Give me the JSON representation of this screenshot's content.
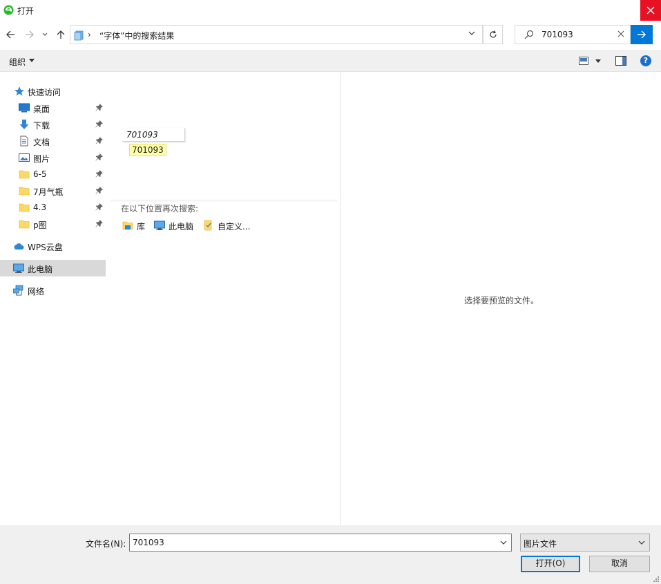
{
  "window": {
    "title": "打开",
    "accent": "#0078d7",
    "close_color": "#e81123"
  },
  "nav": {
    "address_separator": "›",
    "address_path": "“字体”中的搜索结果",
    "search_value": "701093",
    "search_placeholder": ""
  },
  "toolbar": {
    "organize_label": "组织",
    "help_label": "?"
  },
  "sidebar": {
    "quick_access": "快速访问",
    "items": [
      {
        "label": "桌面",
        "icon": "desktop-icon",
        "pinned": true
      },
      {
        "label": "下载",
        "icon": "download-icon",
        "pinned": true
      },
      {
        "label": "文档",
        "icon": "document-icon",
        "pinned": true
      },
      {
        "label": "图片",
        "icon": "picture-icon",
        "pinned": true
      },
      {
        "label": "6-5",
        "icon": "folder-icon",
        "pinned": true
      },
      {
        "label": "7月气瓶",
        "icon": "folder-icon",
        "pinned": true
      },
      {
        "label": "4.3",
        "icon": "folder-icon",
        "pinned": true
      },
      {
        "label": "p图",
        "icon": "folder-icon",
        "pinned": true
      }
    ],
    "wps_cloud": "WPS云盘",
    "this_pc": "此电脑",
    "network": "网络"
  },
  "content": {
    "search_card_text": "701093",
    "highlight_text": "701093",
    "search_again_label": "在以下位置再次搜索:",
    "locations": [
      {
        "label": "库",
        "icon": "library-icon"
      },
      {
        "label": "此电脑",
        "icon": "computer-icon"
      },
      {
        "label": "自定义...",
        "icon": "custom-folder-icon"
      }
    ]
  },
  "preview": {
    "placeholder": "选择要预览的文件。"
  },
  "footer": {
    "filename_label": "文件名(N):",
    "filename_value": "701093",
    "filetype_value": "图片文件",
    "open_button": "打开(O)",
    "cancel_button": "取消"
  }
}
